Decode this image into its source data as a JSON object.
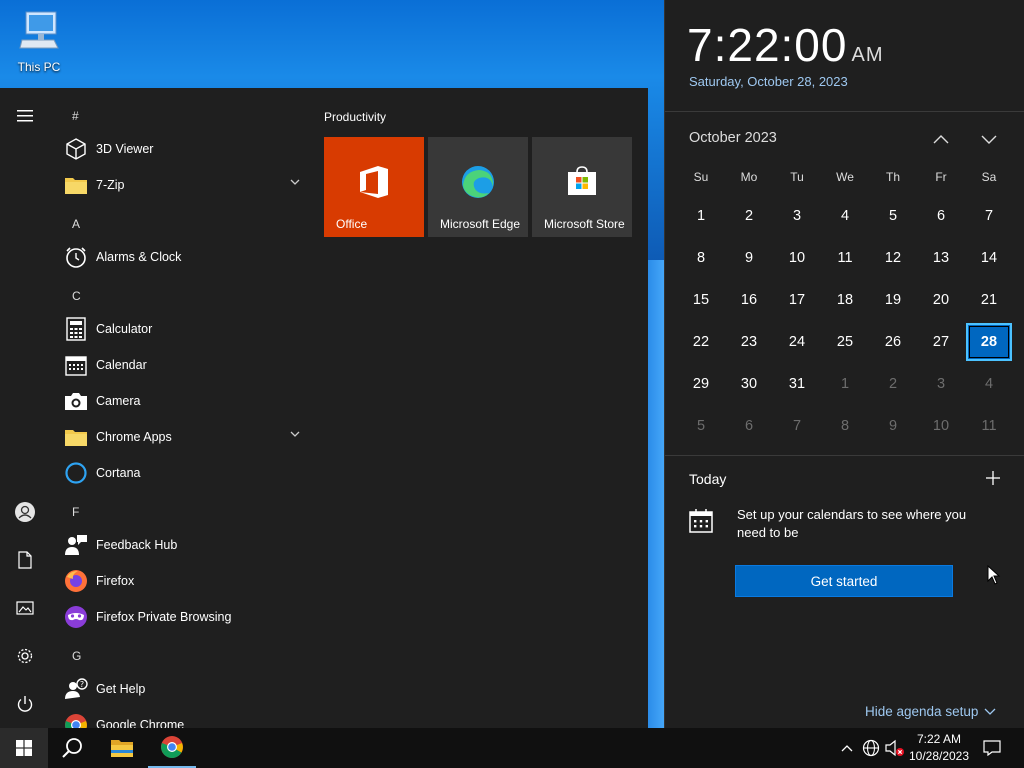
{
  "desktop": {
    "icons": [
      {
        "label": "This PC",
        "icon": "computer-icon"
      }
    ]
  },
  "start_menu": {
    "rail": [
      "hamburger-icon",
      "user-icon",
      "documents-icon",
      "pictures-icon",
      "settings-icon",
      "power-icon"
    ],
    "groups": [
      {
        "letter": "#",
        "apps": [
          {
            "name": "3D Viewer",
            "icon": "cube-icon"
          },
          {
            "name": "7-Zip",
            "icon": "folder-icon",
            "expandable": true
          }
        ]
      },
      {
        "letter": "A",
        "apps": [
          {
            "name": "Alarms & Clock",
            "icon": "alarm-clock-icon"
          }
        ]
      },
      {
        "letter": "C",
        "apps": [
          {
            "name": "Calculator",
            "icon": "calculator-icon"
          },
          {
            "name": "Calendar",
            "icon": "calendar-icon"
          },
          {
            "name": "Camera",
            "icon": "camera-icon"
          },
          {
            "name": "Chrome Apps",
            "icon": "folder-icon",
            "expandable": true
          },
          {
            "name": "Cortana",
            "icon": "cortana-icon"
          }
        ]
      },
      {
        "letter": "F",
        "apps": [
          {
            "name": "Feedback Hub",
            "icon": "feedback-icon"
          },
          {
            "name": "Firefox",
            "icon": "firefox-icon"
          },
          {
            "name": "Firefox Private Browsing",
            "icon": "firefox-private-icon"
          }
        ]
      },
      {
        "letter": "G",
        "apps": [
          {
            "name": "Get Help",
            "icon": "help-icon"
          },
          {
            "name": "Google Chrome",
            "icon": "chrome-icon"
          }
        ]
      }
    ],
    "tiles_group_title": "Productivity",
    "tiles": [
      {
        "label": "Office",
        "icon": "office-icon",
        "color": "#d83b01"
      },
      {
        "label": "Microsoft Edge",
        "icon": "edge-icon",
        "color": "#383838"
      },
      {
        "label": "Microsoft Store",
        "icon": "store-icon",
        "color": "#383838"
      }
    ]
  },
  "calendar_flyout": {
    "time": "7:22:00",
    "ampm": "AM",
    "date": "Saturday, October 28, 2023",
    "month_title": "October 2023",
    "weekdays": [
      "Su",
      "Mo",
      "Tu",
      "We",
      "Th",
      "Fr",
      "Sa"
    ],
    "weeks": [
      [
        {
          "d": "1"
        },
        {
          "d": "2"
        },
        {
          "d": "3"
        },
        {
          "d": "4"
        },
        {
          "d": "5"
        },
        {
          "d": "6"
        },
        {
          "d": "7"
        }
      ],
      [
        {
          "d": "8"
        },
        {
          "d": "9"
        },
        {
          "d": "10"
        },
        {
          "d": "11"
        },
        {
          "d": "12"
        },
        {
          "d": "13"
        },
        {
          "d": "14"
        }
      ],
      [
        {
          "d": "15"
        },
        {
          "d": "16"
        },
        {
          "d": "17"
        },
        {
          "d": "18"
        },
        {
          "d": "19"
        },
        {
          "d": "20"
        },
        {
          "d": "21"
        }
      ],
      [
        {
          "d": "22"
        },
        {
          "d": "23"
        },
        {
          "d": "24"
        },
        {
          "d": "25"
        },
        {
          "d": "26"
        },
        {
          "d": "27"
        },
        {
          "d": "28",
          "today": true
        }
      ],
      [
        {
          "d": "29"
        },
        {
          "d": "30"
        },
        {
          "d": "31"
        },
        {
          "d": "1",
          "other": true
        },
        {
          "d": "2",
          "other": true
        },
        {
          "d": "3",
          "other": true
        },
        {
          "d": "4",
          "other": true
        }
      ],
      [
        {
          "d": "5",
          "other": true
        },
        {
          "d": "6",
          "other": true
        },
        {
          "d": "7",
          "other": true
        },
        {
          "d": "8",
          "other": true
        },
        {
          "d": "9",
          "other": true
        },
        {
          "d": "10",
          "other": true
        },
        {
          "d": "11",
          "other": true
        }
      ]
    ],
    "today_label": "Today",
    "setup_message": "Set up your calendars to see where you need to be",
    "get_started_label": "Get started",
    "hide_agenda_label": "Hide agenda setup",
    "accent": "#0067c0"
  },
  "taskbar": {
    "pinned": [
      {
        "icon": "windows-start-icon"
      },
      {
        "icon": "search-icon"
      },
      {
        "icon": "file-explorer-icon"
      },
      {
        "icon": "chrome-icon"
      }
    ],
    "tray_icons": [
      "chevron-up-icon",
      "network-icon",
      "volume-muted-icon"
    ],
    "clock_time": "7:22 AM",
    "clock_date": "10/28/2023",
    "notification_icon": "action-center-icon"
  }
}
